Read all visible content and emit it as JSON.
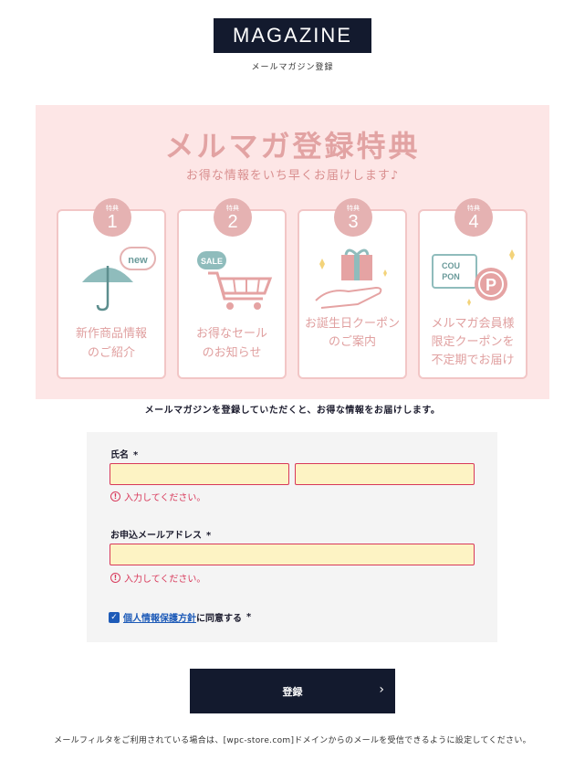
{
  "header": {
    "logo": "MAGAZINE",
    "subtitle": "メールマガジン登録"
  },
  "banner": {
    "title": "メルマガ登録特典",
    "subtitle": "お得な情報をいち早くお届けします♪",
    "badge_label": "特典",
    "benefits": [
      {
        "number": "1",
        "line1": "新作商品情報",
        "line2": "のご紹介",
        "icon": "umbrella-new-icon",
        "icon_text": "new"
      },
      {
        "number": "2",
        "line1": "お得なセール",
        "line2": "のお知らせ",
        "icon": "shopping-cart-sale-icon",
        "icon_text": "SALE"
      },
      {
        "number": "3",
        "line1": "お誕生日クーポン",
        "line2": "のご案内",
        "icon": "gift-hand-icon"
      },
      {
        "number": "4",
        "line1": "メルマガ会員様",
        "line2": "限定クーポンを",
        "line3": "不定期でお届け",
        "icon": "coupon-points-icon",
        "icon_text1": "COU",
        "icon_text2": "PON",
        "icon_text3": "P"
      }
    ]
  },
  "intro": "メールマガジンを登録していただくと、お得な情報をお届けします。",
  "form": {
    "name_label": "氏名",
    "required_mark": "*",
    "last_name_value": "",
    "first_name_value": "",
    "error_text": "入力してください。",
    "email_label": "お申込メールアドレス",
    "email_value": "",
    "agree_policy": "個人情報保護方針",
    "agree_suffix": "に同意する",
    "agreed": true
  },
  "submit_label": "登録",
  "footer": "メールフィルタをご利用されている場合は、[wpc-store.com]ドメインからのメールを受信できるように設定してください。",
  "colors": {
    "navy": "#131a2e",
    "banner_bg": "#fde6e6",
    "pink": "#e5b2b2",
    "teal": "#8fbcbc",
    "error": "#d8385a",
    "input_bg": "#fdf3c4",
    "link": "#1e5bb8"
  }
}
